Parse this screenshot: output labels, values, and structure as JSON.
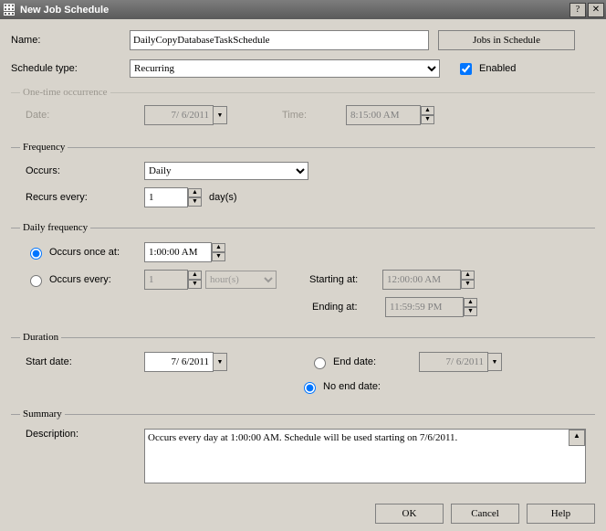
{
  "window": {
    "title": "New Job Schedule"
  },
  "labels": {
    "name": "Name:",
    "schedule_type": "Schedule type:",
    "enabled": "Enabled",
    "one_time": "One-time occurrence",
    "date": "Date:",
    "time": "Time:",
    "frequency": "Frequency",
    "occurs": "Occurs:",
    "recurs_every": "Recurs every:",
    "days": "day(s)",
    "daily_freq": "Daily frequency",
    "occurs_once": "Occurs once at:",
    "occurs_every": "Occurs every:",
    "hours": "hour(s)",
    "starting_at": "Starting at:",
    "ending_at": "Ending at:",
    "duration": "Duration",
    "start_date": "Start date:",
    "end_date": "End date:",
    "no_end_date": "No end date:",
    "summary": "Summary",
    "description": "Description:"
  },
  "buttons": {
    "jobs_in_schedule": "Jobs in Schedule",
    "ok": "OK",
    "cancel": "Cancel",
    "help": "Help"
  },
  "values": {
    "name": "DailyCopyDatabaseTaskSchedule",
    "schedule_type": "Recurring",
    "enabled": true,
    "one_time_date": "7/ 6/2011",
    "one_time_time": "8:15:00 AM",
    "occurs": "Daily",
    "recurs_every": "1",
    "occurs_once_time": "1:00:00 AM",
    "occurs_every_n": "1",
    "occurs_every_unit": "hour(s)",
    "starting_at": "12:00:00 AM",
    "ending_at": "11:59:59 PM",
    "start_date": "7/ 6/2011",
    "end_date": "7/ 6/2011",
    "daily_mode": "once",
    "end_mode": "no_end",
    "description": "Occurs every day at 1:00:00 AM. Schedule will be used starting on 7/6/2011."
  }
}
